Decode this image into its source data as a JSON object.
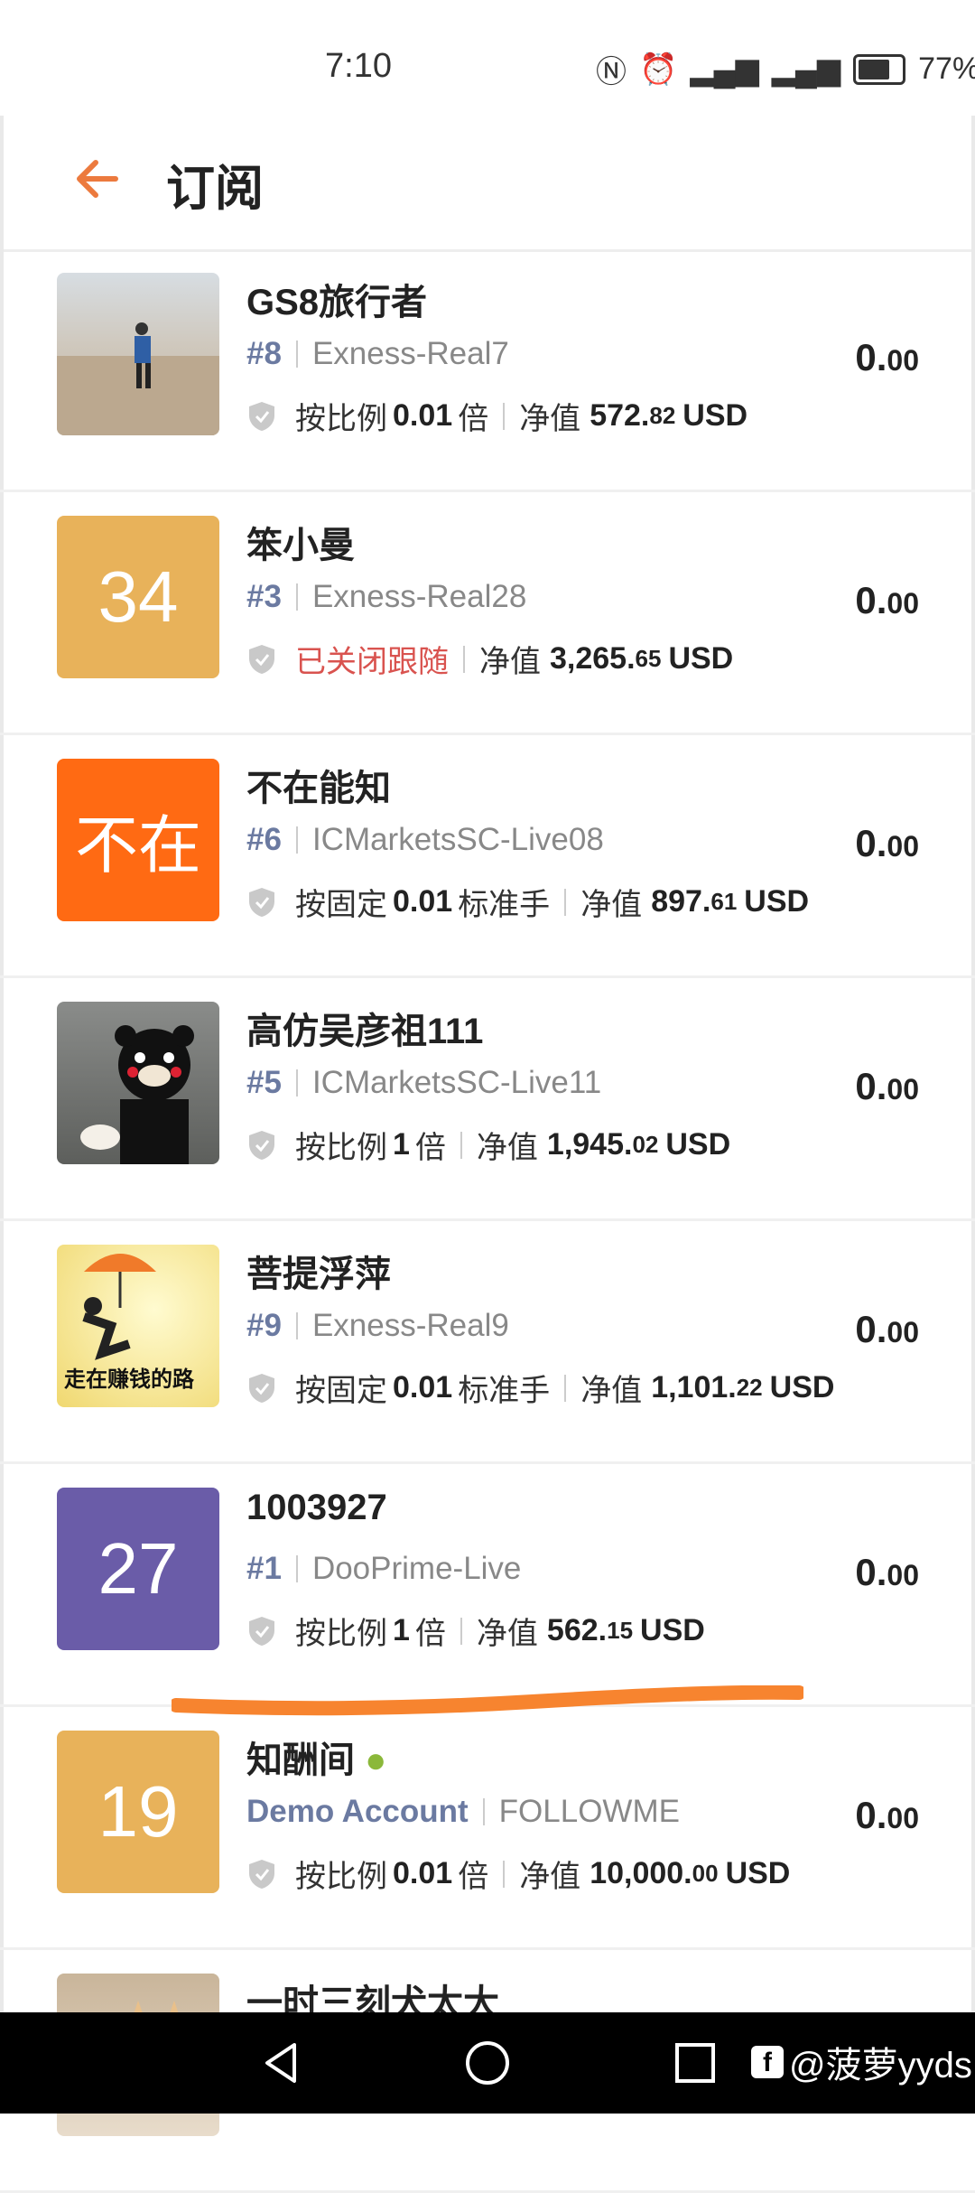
{
  "status": {
    "time": "7:10",
    "battery": "77%"
  },
  "header": {
    "title": "订阅"
  },
  "rows": [
    {
      "name": "GS8旅行者",
      "rank": "#8",
      "broker": "Exness-Real7",
      "mode_prefix": "按比例",
      "mode_value": "0.01",
      "mode_suffix": "倍",
      "equity_label": "净值",
      "equity_int": "572.",
      "equity_dec": "82",
      "currency": "USD",
      "amount_int": "0.",
      "amount_dec": "00"
    },
    {
      "name": "笨小曼",
      "rank": "#3",
      "broker": "Exness-Real28",
      "status_text": "已关闭跟随",
      "equity_label": "净值",
      "equity_int": "3,265.",
      "equity_dec": "65",
      "currency": "USD",
      "amount_int": "0.",
      "amount_dec": "00",
      "avatar_text": "34"
    },
    {
      "name": "不在能知",
      "rank": "#6",
      "broker": "ICMarketsSC-Live08",
      "mode_prefix": "按固定",
      "mode_value": "0.01",
      "mode_suffix": "标准手",
      "equity_label": "净值",
      "equity_int": "897.",
      "equity_dec": "61",
      "currency": "USD",
      "amount_int": "0.",
      "amount_dec": "00",
      "avatar_text": "不在"
    },
    {
      "name": "高仿吴彦祖111",
      "rank": "#5",
      "broker": "ICMarketsSC-Live11",
      "mode_prefix": "按比例",
      "mode_value": "1",
      "mode_suffix": "倍",
      "equity_label": "净值",
      "equity_int": "1,945.",
      "equity_dec": "02",
      "currency": "USD",
      "amount_int": "0.",
      "amount_dec": "00"
    },
    {
      "name": "菩提浮萍",
      "rank": "#9",
      "broker": "Exness-Real9",
      "mode_prefix": "按固定",
      "mode_value": "0.01",
      "mode_suffix": "标准手",
      "equity_label": "净值",
      "equity_int": "1,101.",
      "equity_dec": "22",
      "currency": "USD",
      "amount_int": "0.",
      "amount_dec": "00",
      "avatar_text": "走在赚钱的路"
    },
    {
      "name": "1003927",
      "rank": "#1",
      "broker": "DooPrime-Live",
      "mode_prefix": "按比例",
      "mode_value": "1",
      "mode_suffix": "倍",
      "equity_label": "净值",
      "equity_int": "562.",
      "equity_dec": "15",
      "currency": "USD",
      "amount_int": "0.",
      "amount_dec": "00",
      "avatar_text": "27"
    },
    {
      "name": "知酬间",
      "rank": "Demo Account",
      "broker": "FOLLOWME",
      "mode_prefix": "按比例",
      "mode_value": "0.01",
      "mode_suffix": "倍",
      "equity_label": "净值",
      "equity_int": "10,000.",
      "equity_dec": "00",
      "currency": "USD",
      "amount_int": "0.",
      "amount_dec": "00",
      "avatar_text": "19"
    },
    {
      "name": "一时三刻犬太大"
    }
  ],
  "watermark": {
    "icon": "f",
    "text": "@菠萝yyds"
  },
  "colors": {
    "accent": "#ec7a3e",
    "rank": "#6b7aa1",
    "closed": "#d9534f",
    "avatar_yellow": "#e8b25a",
    "avatar_orange": "#ff6a13",
    "avatar_purple": "#6a5ca8"
  }
}
